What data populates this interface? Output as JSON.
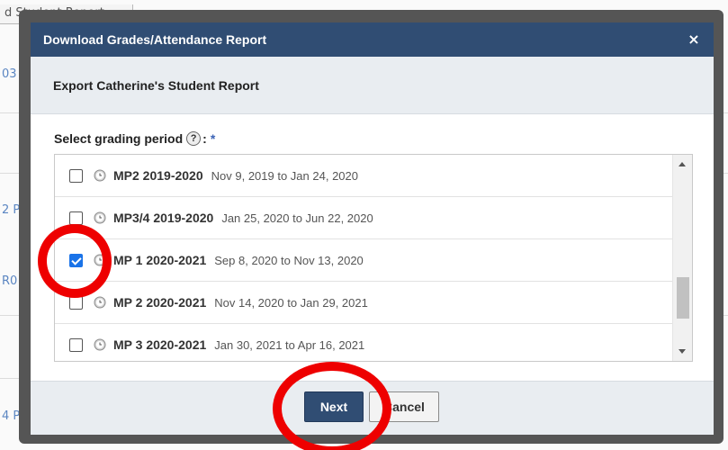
{
  "background": {
    "tab_label": "d Student Report",
    "edge_labels": [
      "03",
      "2 P",
      "R0",
      "4 P"
    ]
  },
  "dialog": {
    "title": "Download Grades/Attendance Report",
    "close_label": "×",
    "subtitle": "Export Catherine's Student Report",
    "field_label": "Select grading period",
    "help_label": "?",
    "label_colon": ":",
    "required_mark": "*",
    "periods": [
      {
        "name": "MP2 2019-2020",
        "dates": "Nov 9, 2019 to Jan 24, 2020",
        "checked": false
      },
      {
        "name": "MP3/4 2019-2020",
        "dates": "Jan 25, 2020 to Jun 22, 2020",
        "checked": false
      },
      {
        "name": "MP 1 2020-2021",
        "dates": "Sep 8, 2020 to Nov 13, 2020",
        "checked": true
      },
      {
        "name": "MP 2 2020-2021",
        "dates": "Nov 14, 2020 to Jan 29, 2021",
        "checked": false
      },
      {
        "name": "MP 3 2020-2021",
        "dates": "Jan 30, 2021 to Apr 16, 2021",
        "checked": false
      }
    ],
    "buttons": {
      "next": "Next",
      "cancel": "Cancel"
    }
  },
  "colors": {
    "header": "#304d73",
    "annotation": "#ee0000",
    "checkbox_checked": "#1a73e8"
  }
}
